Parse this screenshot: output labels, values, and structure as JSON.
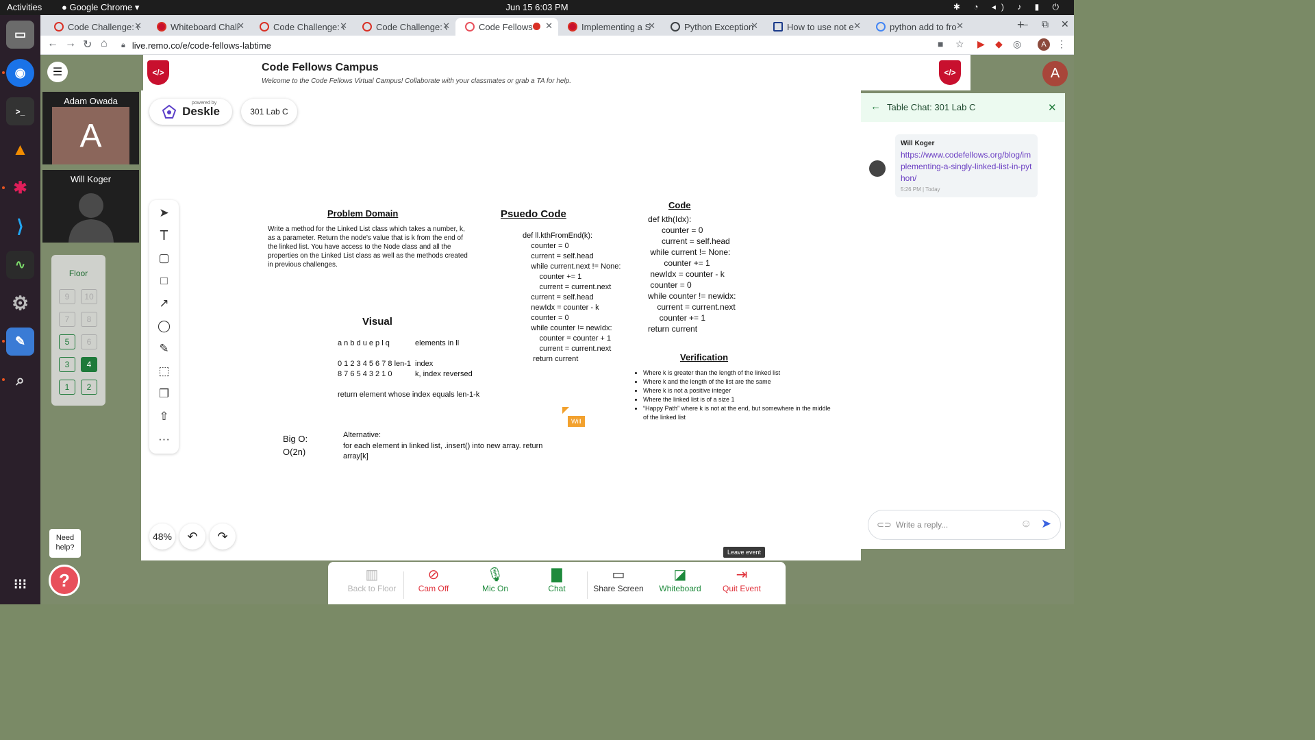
{
  "topbar": {
    "activities": "Activities",
    "app_name": "Google Chrome",
    "clock": "Jun 15  6:03 PM"
  },
  "browser": {
    "tabs": [
      {
        "label": "Code Challenge: C"
      },
      {
        "label": "Whiteboard Chall"
      },
      {
        "label": "Code Challenge: C"
      },
      {
        "label": "Code Challenge: C"
      },
      {
        "label": "Code Fellows"
      },
      {
        "label": "Implementing a S"
      },
      {
        "label": "Python Exception"
      },
      {
        "label": "How to use not e"
      },
      {
        "label": "python add to fro"
      }
    ],
    "url": "live.remo.co/e/code-fellows-labtime",
    "profile_initial": "A"
  },
  "campus": {
    "title": "Code Fellows Campus",
    "subtitle": "Welcome to the Code Fellows Virtual Campus! Collaborate with your classmates or grab a TA for help.",
    "logo_glyph": "</>",
    "user_initial": "A"
  },
  "video": {
    "tiles": [
      {
        "name": "Adam Owada",
        "initial": "A"
      },
      {
        "name": "Will Koger"
      }
    ]
  },
  "floor": {
    "title": "Floor",
    "buttons": [
      "9",
      "10",
      "7",
      "8",
      "5",
      "6",
      "3",
      "4",
      "1",
      "2"
    ],
    "current": "4"
  },
  "whiteboard": {
    "powered_by": "powered by",
    "brand": "Deskle",
    "room": "301 Lab C",
    "zoom": "48%",
    "problem_domain": {
      "heading": "Problem Domain",
      "text": "Write a method for the Linked List class which takes a number, k, as a parameter. Return the node's value that is k from the end of the linked list. You have access to the Node class and all the properties on the Linked List class as well as the methods created in previous challenges."
    },
    "pseudo": {
      "heading": "Psuedo Code",
      "lines": [
        "def ll.kthFromEnd(k):",
        "    counter = 0",
        "    current = self.head",
        "    while current.next != None:",
        "        counter += 1",
        "        current = current.next",
        "    current = self.head",
        "    newIdx = counter - k",
        "    counter = 0",
        "    while counter != newIdx:",
        "        counter = counter + 1",
        "        current = current.next",
        "     return current"
      ]
    },
    "code": {
      "heading": "Code",
      "lines": [
        "def kth(Idx):",
        "      counter = 0",
        "      current = self.head",
        " while current != None:",
        "       counter += 1",
        " newIdx = counter - k",
        " counter = 0",
        "while counter != newidx:",
        "    current = current.next",
        "     counter += 1",
        "return current"
      ]
    },
    "visual": {
      "heading": "Visual",
      "row1_left": "a n b d u e p l q",
      "row1_right": "elements in ll",
      "row2_left": "0 1 2 3 4 5 6 7 8 len-1",
      "row2_right": "index",
      "row3_left": "8 7 6 5 4 3 2 1 0",
      "row3_right": "k, index reversed",
      "row4": "return element whose index equals len-1-k"
    },
    "verification": {
      "heading": "Verification",
      "items": [
        "Where k is greater than the length of the linked list",
        "Where k and the length of the list are the same",
        "Where k is not a positive integer",
        "Where the linked list is of a size 1",
        "“Happy Path” where k is not at the end, but somewhere in the middle of the linked list"
      ]
    },
    "bigo": {
      "label": "Big O:",
      "value": "O(2n)",
      "alt_label": "Alternative:",
      "alt_text": "for each element in linked list, .insert() into new array. return array[k]"
    },
    "cursor_name": "Will"
  },
  "chat": {
    "title": "Table Chat: 301 Lab C",
    "message": {
      "author": "Will Koger",
      "link": "https://www.codefellows.org/blog/implementing-a-singly-linked-list-in-python/",
      "time": "5:26 PM | Today"
    },
    "reply_placeholder": "Write a reply..."
  },
  "leave_tooltip": "Leave event",
  "bottom_bar": [
    {
      "label": "Back to Floor",
      "color": "#b5b5b5"
    },
    {
      "label": "Cam Off",
      "color": "#e0303a"
    },
    {
      "label": "Mic On",
      "color": "#1e8a3c"
    },
    {
      "label": "Chat",
      "color": "#1e8a3c"
    },
    {
      "label": "Share Screen",
      "color": "#333333"
    },
    {
      "label": "Whiteboard",
      "color": "#1e8a3c"
    },
    {
      "label": "Quit Event",
      "color": "#e0303a"
    }
  ],
  "help": {
    "text": "Need help?",
    "glyph": "?"
  }
}
